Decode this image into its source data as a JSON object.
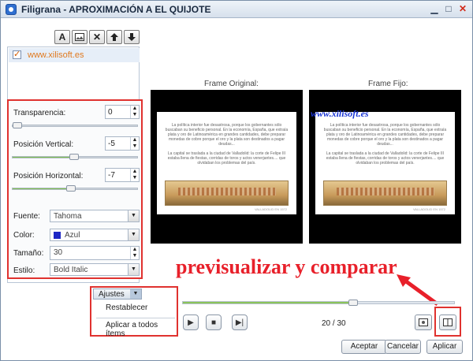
{
  "window": {
    "title": "Filigrana - APROXIMACIÓN A EL QUIJOTE"
  },
  "toolbar": {
    "icons": [
      "text-icon",
      "image-icon",
      "delete-icon",
      "move-up-icon",
      "move-down-icon"
    ],
    "text_label": "A"
  },
  "watermark_list": {
    "items": [
      {
        "label": "www.xilisoft.es",
        "checked": true
      }
    ]
  },
  "properties": {
    "transparencia": {
      "label": "Transparencia:",
      "value": "0",
      "slider_fraction": 0
    },
    "pos_vertical": {
      "label": "Posición Vertical:",
      "value": "-5",
      "slider_fraction": 0.47
    },
    "pos_horizontal": {
      "label": "Posición Horizontal:",
      "value": "-7",
      "slider_fraction": 0.46
    },
    "fuente": {
      "label": "Fuente:",
      "value": "Tahoma"
    },
    "color": {
      "label": "Color:",
      "value": "Azul",
      "swatch": "#1d27c5"
    },
    "tamano": {
      "label": "Tamaño:",
      "value": "30"
    },
    "estilo": {
      "label": "Estilo:",
      "value": "Bold Italic"
    }
  },
  "preview": {
    "original_label": "Frame Original:",
    "fixed_label": "Frame Fijo:",
    "watermark_text": "www.xilisoft.es",
    "page_text_1": "La política interior fue desastrosa, porque los gobernantes sólo buscaban su beneficio personal. En la economía, España, que extraía plata y oro de Latinoamérica en grandes cantidades, debe preparar monedas de cobre porque el oro y la plata son destinados a pagar deudas...",
    "page_text_2": "La capital se traslada a la ciudad de Valladolid: la corte de Felipe III estaba llena de fiestas, corridas de toros y actos venerjantes.... que olvidaban los problemas del país.",
    "page_footer": "VALLADOLID EN 1572"
  },
  "annotation": {
    "text": "previsualizar y comparar",
    "color": "#e8202a"
  },
  "timeline": {
    "progress": 0.61
  },
  "ajustes": {
    "label": "Ajustes",
    "items": [
      "Restablecer",
      "Aplicar a todos ítems"
    ]
  },
  "playback": {
    "counter": "20 / 30"
  },
  "footer": {
    "accept": "Aceptar",
    "cancel": "Cancelar",
    "apply": "Aplicar"
  }
}
